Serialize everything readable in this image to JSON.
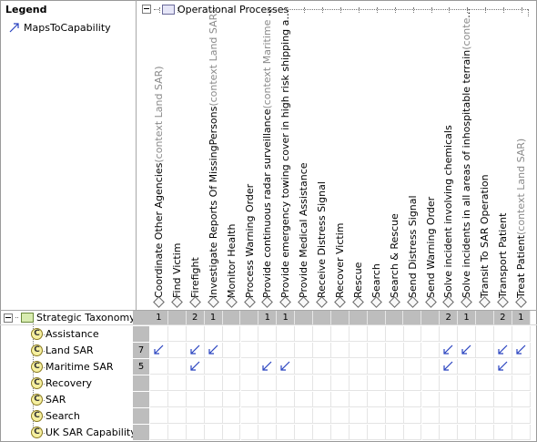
{
  "legend": {
    "title": "Legend",
    "items": [
      {
        "label": "MapsToCapability",
        "icon": "arrow-icon"
      }
    ]
  },
  "operational": {
    "title": "Operational Processes",
    "columns": [
      {
        "name": "Coordinate Other Agencies",
        "ctx": "(context Land SAR)"
      },
      {
        "name": "Find Victim",
        "ctx": ""
      },
      {
        "name": "Firefight",
        "ctx": ""
      },
      {
        "name": "Investigate Reports Of MissingPersons",
        "ctx": "(context Land SAR)"
      },
      {
        "name": "Monitor Health",
        "ctx": ""
      },
      {
        "name": "Process Warning Order",
        "ctx": ""
      },
      {
        "name": "Provide continuous radar surveillance",
        "ctx": "(context Maritime SAR)"
      },
      {
        "name": "Provide emergency towing cover in high risk shipping area",
        "ctx": "(c..."
      },
      {
        "name": "Provide Medical Assistance",
        "ctx": ""
      },
      {
        "name": "Receive Distress Signal",
        "ctx": ""
      },
      {
        "name": "Recover Victim",
        "ctx": ""
      },
      {
        "name": "Rescue",
        "ctx": ""
      },
      {
        "name": "Search",
        "ctx": ""
      },
      {
        "name": "Search & Rescue",
        "ctx": ""
      },
      {
        "name": "Send Distress Signal",
        "ctx": ""
      },
      {
        "name": "Send Warning Order",
        "ctx": ""
      },
      {
        "name": "Solve incident involving chemicals",
        "ctx": ""
      },
      {
        "name": "Solve incidents in all areas of inhospitable terrain",
        "ctx": "(context La..."
      },
      {
        "name": "Transit To SAR Operation",
        "ctx": ""
      },
      {
        "name": "Transport Patient",
        "ctx": ""
      },
      {
        "name": "Treat Patient",
        "ctx": "(context Land SAR)"
      }
    ],
    "column_counts": [
      "1",
      "",
      "2",
      "1",
      "",
      "",
      "1",
      "1",
      "",
      "",
      "",
      "",
      "",
      "",
      "",
      "",
      "2",
      "1",
      "",
      "2",
      "1"
    ]
  },
  "strategic": {
    "title": "Strategic Taxonomy",
    "rows": [
      {
        "label": "Assistance",
        "count": "",
        "marks": []
      },
      {
        "label": "Land SAR",
        "count": "7",
        "marks": [
          0,
          2,
          3,
          16,
          17,
          19,
          20
        ]
      },
      {
        "label": "Maritime SAR",
        "count": "5",
        "marks": [
          2,
          6,
          7,
          16,
          19
        ]
      },
      {
        "label": "Recovery",
        "count": "",
        "marks": []
      },
      {
        "label": "SAR",
        "count": "",
        "marks": []
      },
      {
        "label": "Search",
        "count": "",
        "marks": []
      },
      {
        "label": "UK SAR Capability",
        "count": "",
        "marks": []
      }
    ]
  },
  "colors": {
    "accent": "#2a44c0",
    "header_gray": "#bdbdbd",
    "grid": "#e4e4e4"
  }
}
